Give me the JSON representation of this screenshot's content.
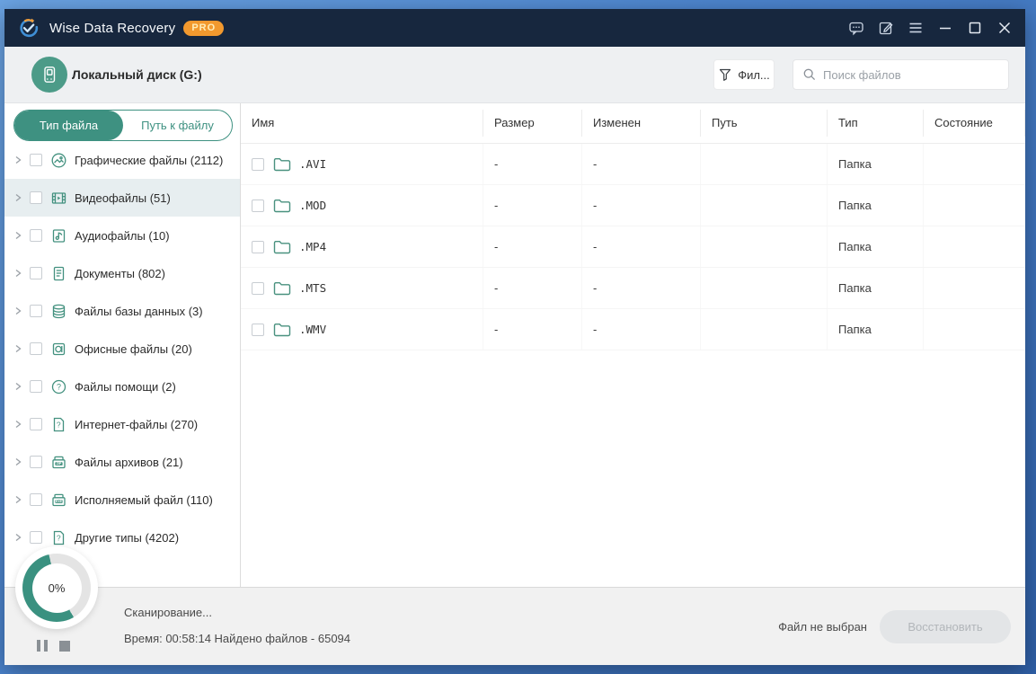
{
  "window": {
    "title": "Wise Data Recovery",
    "badge": "PRO"
  },
  "titlebar": {
    "icons": [
      "feedback-icon",
      "edit-icon",
      "menu-icon",
      "minimize-icon",
      "maximize-icon",
      "close-icon"
    ]
  },
  "header": {
    "device": "Локальный диск (G:)",
    "device_icon": "drive-icon",
    "filter_label": "Фил...",
    "filter_icon": "filter-icon",
    "search_icon": "search-icon",
    "search_placeholder": "Поиск файлов",
    "search_value": ""
  },
  "sidebar": {
    "tabs": [
      {
        "label": "Тип файла",
        "active": true
      },
      {
        "label": "Путь к файлу",
        "active": false
      }
    ],
    "items": [
      {
        "id": "graphic-files",
        "label": "Графические файлы (2112)",
        "icon": "image-file-icon",
        "selected": false
      },
      {
        "id": "video-files",
        "label": "Видеофайлы (51)",
        "icon": "video-file-icon",
        "selected": true
      },
      {
        "id": "audio-files",
        "label": "Аудиофайлы (10)",
        "icon": "audio-file-icon",
        "selected": false
      },
      {
        "id": "documents",
        "label": "Документы (802)",
        "icon": "document-file-icon",
        "selected": false
      },
      {
        "id": "database-files",
        "label": "Файлы базы данных (3)",
        "icon": "database-file-icon",
        "selected": false
      },
      {
        "id": "office-files",
        "label": "Офисные файлы (20)",
        "icon": "office-file-icon",
        "selected": false
      },
      {
        "id": "help-files",
        "label": "Файлы помощи (2)",
        "icon": "help-file-icon",
        "selected": false
      },
      {
        "id": "internet-files",
        "label": "Интернет-файлы (270)",
        "icon": "internet-file-icon",
        "selected": false
      },
      {
        "id": "archive-files",
        "label": "Файлы архивов (21)",
        "icon": "archive-file-icon",
        "selected": false
      },
      {
        "id": "executable-files",
        "label": "Исполняемый файл (110)",
        "icon": "exe-file-icon",
        "selected": false
      },
      {
        "id": "other-types",
        "label": "Другие типы (4202)",
        "icon": "other-file-icon",
        "selected": false
      }
    ]
  },
  "table": {
    "columns": [
      "Имя",
      "Размер",
      "Изменен",
      "Путь",
      "Тип",
      "Состояние"
    ],
    "rows": [
      {
        "name": ".AVI",
        "size": "-",
        "modified": "-",
        "path": "",
        "type": "Папка",
        "state": ""
      },
      {
        "name": ".MOD",
        "size": "-",
        "modified": "-",
        "path": "",
        "type": "Папка",
        "state": ""
      },
      {
        "name": ".MP4",
        "size": "-",
        "modified": "-",
        "path": "",
        "type": "Папка",
        "state": ""
      },
      {
        "name": ".MTS",
        "size": "-",
        "modified": "-",
        "path": "",
        "type": "Папка",
        "state": ""
      },
      {
        "name": ".WMV",
        "size": "-",
        "modified": "-",
        "path": "",
        "type": "Папка",
        "state": ""
      }
    ]
  },
  "statusbar": {
    "progress": "0%",
    "status": "Сканирование...",
    "time_line": "Время: 00:58:14 Найдено файлов - 65094",
    "selection": "Файл не выбран",
    "restore_label": "Восстановить"
  },
  "colors": {
    "accent_teal": "#3e9181",
    "titlebar_navy": "#17273e",
    "badge_orange": "#f2992e",
    "selected_row": "#e7eef0",
    "progress_green": "#3a9180"
  }
}
